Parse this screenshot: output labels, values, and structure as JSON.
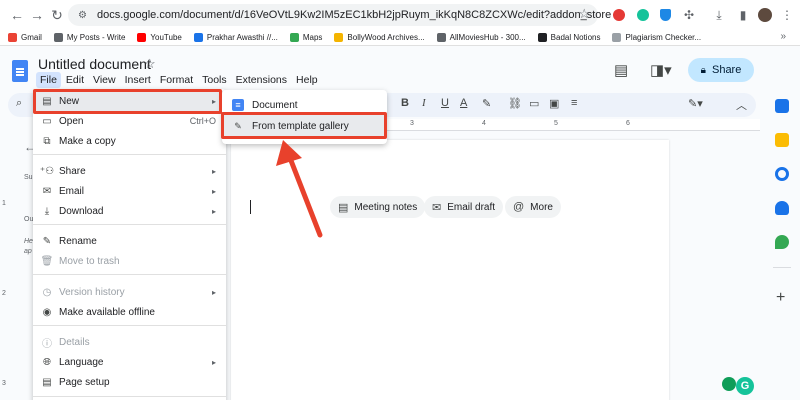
{
  "browser": {
    "url": "docs.google.com/document/d/16VeOVtL9Kw2IM5zEC1kbH2jpRuym_ikKqN8C8ZCXWc/edit?addon_store",
    "bookmarks": [
      "Gmail",
      "My Posts - Write",
      "YouTube",
      "Prakhar Awasthi //...",
      "Maps",
      "BollyWood Archives...",
      "AllMoviesHub - 300...",
      "Badal Notions",
      "Plagiarism Checker..."
    ],
    "bookmark_colors": [
      "#ea4335",
      "#5f6368",
      "#ff0000",
      "#1a73e8",
      "#34a853",
      "#f4b400",
      "#5f6368",
      "#202124",
      "#9aa0a6"
    ]
  },
  "document": {
    "title": "Untitled document",
    "menus": [
      "File",
      "Edit",
      "View",
      "Insert",
      "Format",
      "Tools",
      "Extensions",
      "Help"
    ],
    "share_label": "Share"
  },
  "file_menu": {
    "items": [
      {
        "label": "New",
        "icon": "document-icon",
        "shortcut": "",
        "submenu": true,
        "disabled": false
      },
      {
        "label": "Open",
        "icon": "folder-icon",
        "shortcut": "Ctrl+O",
        "submenu": false,
        "disabled": false
      },
      {
        "label": "Make a copy",
        "icon": "copy-icon",
        "shortcut": "",
        "submenu": false,
        "disabled": false
      },
      {
        "label": "Share",
        "icon": "share-icon",
        "shortcut": "",
        "submenu": true,
        "disabled": false
      },
      {
        "label": "Email",
        "icon": "email-icon",
        "shortcut": "",
        "submenu": true,
        "disabled": false
      },
      {
        "label": "Download",
        "icon": "download-icon",
        "shortcut": "",
        "submenu": true,
        "disabled": false
      },
      {
        "label": "Rename",
        "icon": "rename-icon",
        "shortcut": "",
        "submenu": false,
        "disabled": false
      },
      {
        "label": "Move to trash",
        "icon": "trash-icon",
        "shortcut": "",
        "submenu": false,
        "disabled": true
      },
      {
        "label": "Version history",
        "icon": "history-icon",
        "shortcut": "",
        "submenu": true,
        "disabled": true
      },
      {
        "label": "Make available offline",
        "icon": "offline-icon",
        "shortcut": "",
        "submenu": false,
        "disabled": false
      },
      {
        "label": "Details",
        "icon": "info-icon",
        "shortcut": "",
        "submenu": false,
        "disabled": true
      },
      {
        "label": "Language",
        "icon": "globe-icon",
        "shortcut": "",
        "submenu": true,
        "disabled": false
      },
      {
        "label": "Page setup",
        "icon": "page-setup-icon",
        "shortcut": "",
        "submenu": false,
        "disabled": false
      }
    ]
  },
  "new_submenu": {
    "items": [
      {
        "label": "Document",
        "icon": "docs-icon"
      },
      {
        "label": "From template gallery",
        "icon": "template-icon"
      }
    ]
  },
  "smart_chips": [
    "Meeting notes",
    "Email draft",
    "More"
  ],
  "ruler_marks": [
    "1",
    "2",
    "3",
    "4",
    "5",
    "6"
  ],
  "vruler_marks": [
    "1",
    "2",
    "3"
  ],
  "left_panel": {
    "letters": [
      "Su",
      "Ou",
      "He",
      "ap"
    ]
  },
  "colors": {
    "highlight_red": "#e8412c",
    "share_bg": "#c2e7ff",
    "accent": "#1a73e8"
  }
}
